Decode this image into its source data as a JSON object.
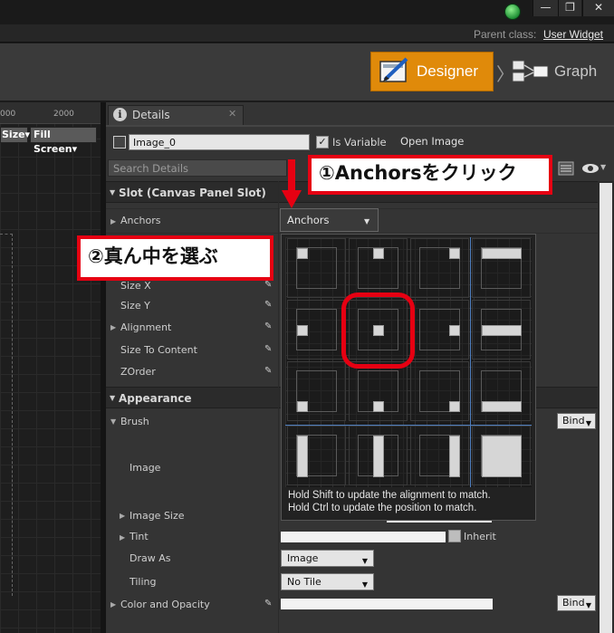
{
  "titlebar": {
    "buttons": {
      "minimize": "—",
      "maximize": "❐",
      "close": "✕"
    },
    "status_icon": "green-status-orb-icon"
  },
  "parent_class": {
    "label": "Parent class:",
    "value": "User Widget"
  },
  "mode_switch": {
    "designer": {
      "label": "Designer",
      "icon": "designer-icon",
      "color": "#e08a0a"
    },
    "separator": "〉",
    "graph": {
      "label": "Graph",
      "icon": "graph-icon"
    }
  },
  "canvas": {
    "ruler": [
      "000",
      "2000"
    ],
    "tools": {
      "size": "Size▾",
      "fill_screen": "Fill Screen▾"
    }
  },
  "details": {
    "tab_label": "Details",
    "tab_icon": "i",
    "tab_close": "✕",
    "name_value": "Image_0",
    "is_variable_label": "Is Variable",
    "is_variable_checked": "✓",
    "open_image": "Open Image",
    "search_placeholder": "Search Details",
    "sections": {
      "slot": "Slot (Canvas Panel Slot)",
      "appearance": "Appearance"
    },
    "slot_props": {
      "anchors": "Anchors",
      "size_x": "Size X",
      "size_y": "Size Y",
      "alignment": "Alignment",
      "size_to_content": "Size To Content",
      "zorder": "ZOrder"
    },
    "appearance_props": {
      "brush": "Brush",
      "image": "Image",
      "image_size": "Image Size",
      "tint": "Tint",
      "draw_as": "Draw As",
      "tiling": "Tiling",
      "color_and_opacity": "Color and Opacity"
    },
    "anchors_combo": "Anchors",
    "draw_as_value": "Image",
    "tiling_value": "No Tile",
    "inherit_label": "Inherit",
    "bind_label": "Bind",
    "arrow_glyph": "▶",
    "caret_glyph": "▼"
  },
  "anchor_popup": {
    "hint_shift": "Hold Shift to update the alignment to match.",
    "hint_ctrl": "Hold Ctrl to update the position to match."
  },
  "annotations": {
    "step1": "①Anchorsをクリック",
    "step2": "②真ん中を選ぶ",
    "color": "#e60012"
  }
}
